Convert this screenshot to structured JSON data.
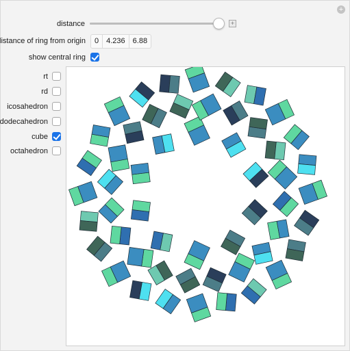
{
  "controls": {
    "distance": {
      "label": "distance",
      "value_fraction": 0.96
    },
    "ring_distance": {
      "label": "distance of ring from origin",
      "values": [
        "0",
        "4.236",
        "6.88"
      ]
    },
    "central_ring": {
      "label": "show central ring",
      "checked": true
    },
    "shapes": [
      {
        "key": "rt",
        "label": "rt",
        "checked": false
      },
      {
        "key": "rd",
        "label": "rd",
        "checked": false
      },
      {
        "key": "icosahedron",
        "label": "icosahedron",
        "checked": false
      },
      {
        "key": "dodecahedron",
        "label": "dodecahedron",
        "checked": false
      },
      {
        "key": "cube",
        "label": "cube",
        "checked": true
      },
      {
        "key": "octahedron",
        "label": "octahedron",
        "checked": false
      }
    ]
  },
  "colors": {
    "accent": "#1a73e8",
    "cube_faces": [
      "#5fd8a0",
      "#3b8dc0",
      "#4ee0f0",
      "#2a3e5a",
      "#4c7d88",
      "#3f6658",
      "#6ec9b0",
      "#2f6fb0"
    ]
  }
}
